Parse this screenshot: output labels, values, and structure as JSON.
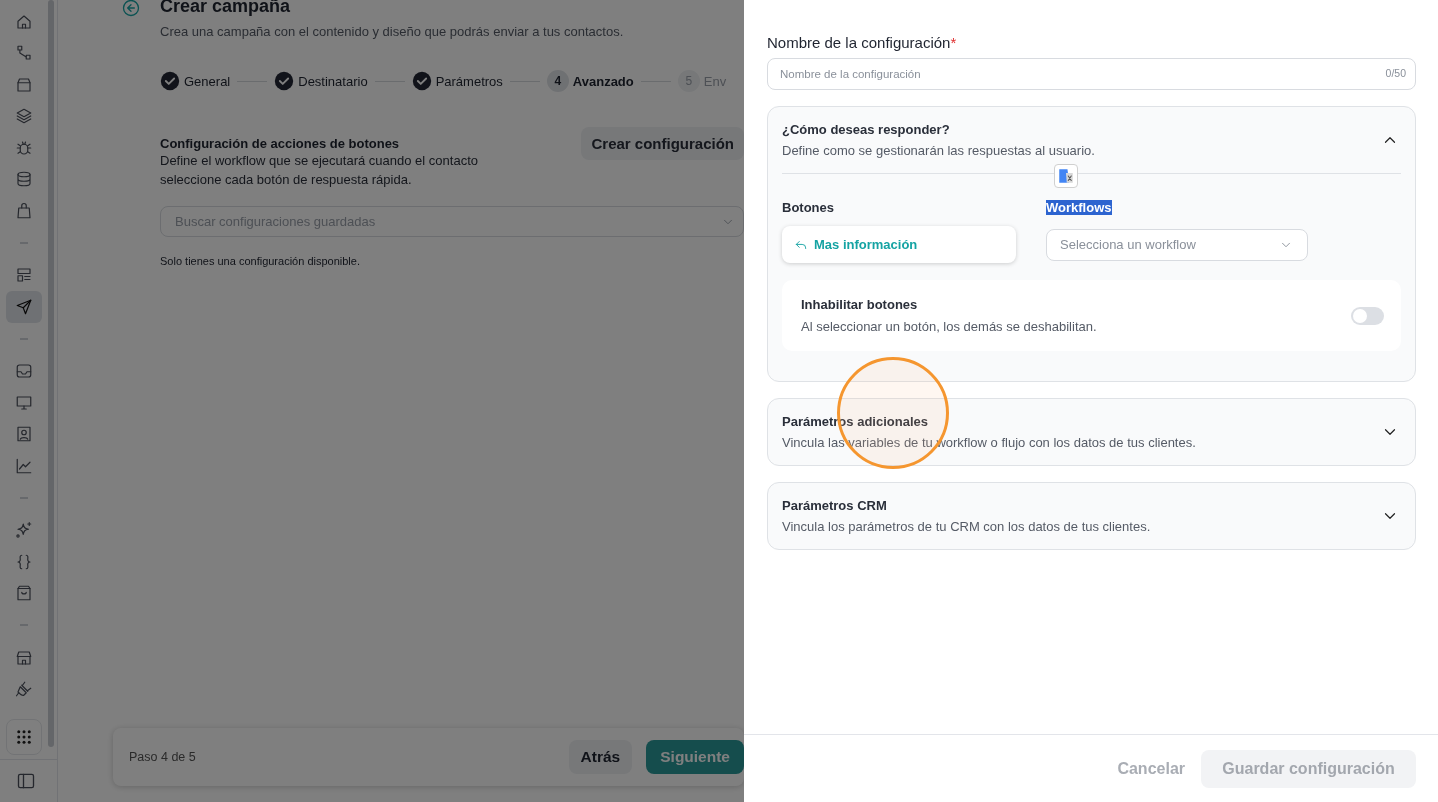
{
  "sidebar": {
    "groups": [
      {
        "items": [
          {
            "selected": false
          },
          {
            "selected": false
          },
          {
            "selected": false
          },
          {
            "selected": false
          },
          {
            "selected": false
          },
          {
            "selected": false
          },
          {
            "selected": false
          }
        ]
      },
      {
        "items": [
          {
            "selected": false
          },
          {
            "selected": true
          }
        ]
      },
      {
        "items": [
          {
            "selected": false
          },
          {
            "selected": false
          },
          {
            "selected": false
          },
          {
            "selected": false
          }
        ]
      },
      {
        "items": [
          {
            "selected": false
          },
          {
            "selected": false
          },
          {
            "selected": false
          }
        ]
      },
      {
        "items": [
          {
            "selected": false
          },
          {
            "selected": false
          }
        ]
      }
    ]
  },
  "page": {
    "title": "Crear campaña",
    "subtitle": "Crea una campaña con el contenido y diseño que podrás enviar a tus contactos.",
    "steps": [
      {
        "label": "General",
        "completed": true,
        "selected": false
      },
      {
        "label": "Destinatario",
        "completed": true,
        "selected": false
      },
      {
        "label": "Parámetros",
        "completed": true,
        "selected": false
      },
      {
        "number": "4",
        "label": "Avanzado",
        "completed": false,
        "selected": true
      },
      {
        "number": "5",
        "label": "Env",
        "completed": false,
        "selected": false
      }
    ],
    "section": {
      "title": "Configuración de acciones de botones",
      "description": "Define el workflow que se ejecutará cuando el contacto seleccione cada botón de respuesta rápida.",
      "create_button": "Crear configuración",
      "search": {
        "placeholder": "Buscar configuraciones guardadas"
      },
      "note": "Solo tienes una configuración disponible."
    },
    "footer": {
      "progress": "Paso 4 de 5",
      "back_button": "Atrás",
      "next_button": "Siguiente"
    }
  },
  "drawer": {
    "name_field": {
      "label": "Nombre de la configuración",
      "required_mark": "*",
      "placeholder": "Nombre de la configuración",
      "counter": "0/50"
    },
    "panels": [
      {
        "title": "¿Cómo deseas responder?",
        "description": "Define como se gestionarán las respuestas al usuario.",
        "expanded": true,
        "buttons_label": "Botones",
        "workflows_label": "Workflows",
        "workflows_label_selected": true,
        "translate_popup": true,
        "rows": [
          {
            "button": "Mas información",
            "workflow": {
              "placeholder": "Selecciona un workflow"
            }
          }
        ],
        "disable_option": {
          "title": "Inhabilitar botones",
          "description": "Al seleccionar un botón, los demás se deshabilitan.",
          "on": false
        }
      },
      {
        "title": "Parámetros adicionales",
        "description": "Vincula las variables de tu workflow o flujo con los datos de tus clientes.",
        "expanded": false
      },
      {
        "title": "Parámetros CRM",
        "description": "Vincula los parámetros de tu CRM con los datos de tus clientes.",
        "expanded": false
      }
    ],
    "cancel_button": {
      "label": "Cancelar",
      "disabled": true
    },
    "save_button": {
      "label": "Guardar configuración",
      "disabled": true
    }
  },
  "click_indicator": true
}
